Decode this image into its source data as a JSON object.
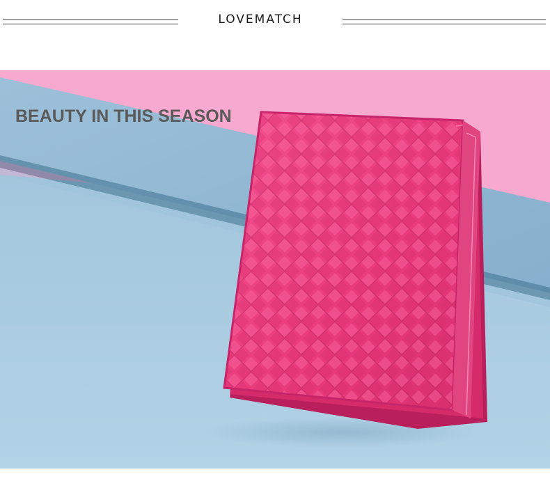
{
  "brand": {
    "name": "LOVEMATCH"
  },
  "banner": {
    "headline": "BEAUTY IN THIS SEASON",
    "product": "pink woven leather card wallet",
    "colors": {
      "background_pink": "#f7a9cf",
      "stripe_blue": "#8fb8d4",
      "floor_blue": "#a9cbe0",
      "wallet_pink": "#ec3b7f",
      "wallet_shadow": "#c2245f"
    }
  }
}
